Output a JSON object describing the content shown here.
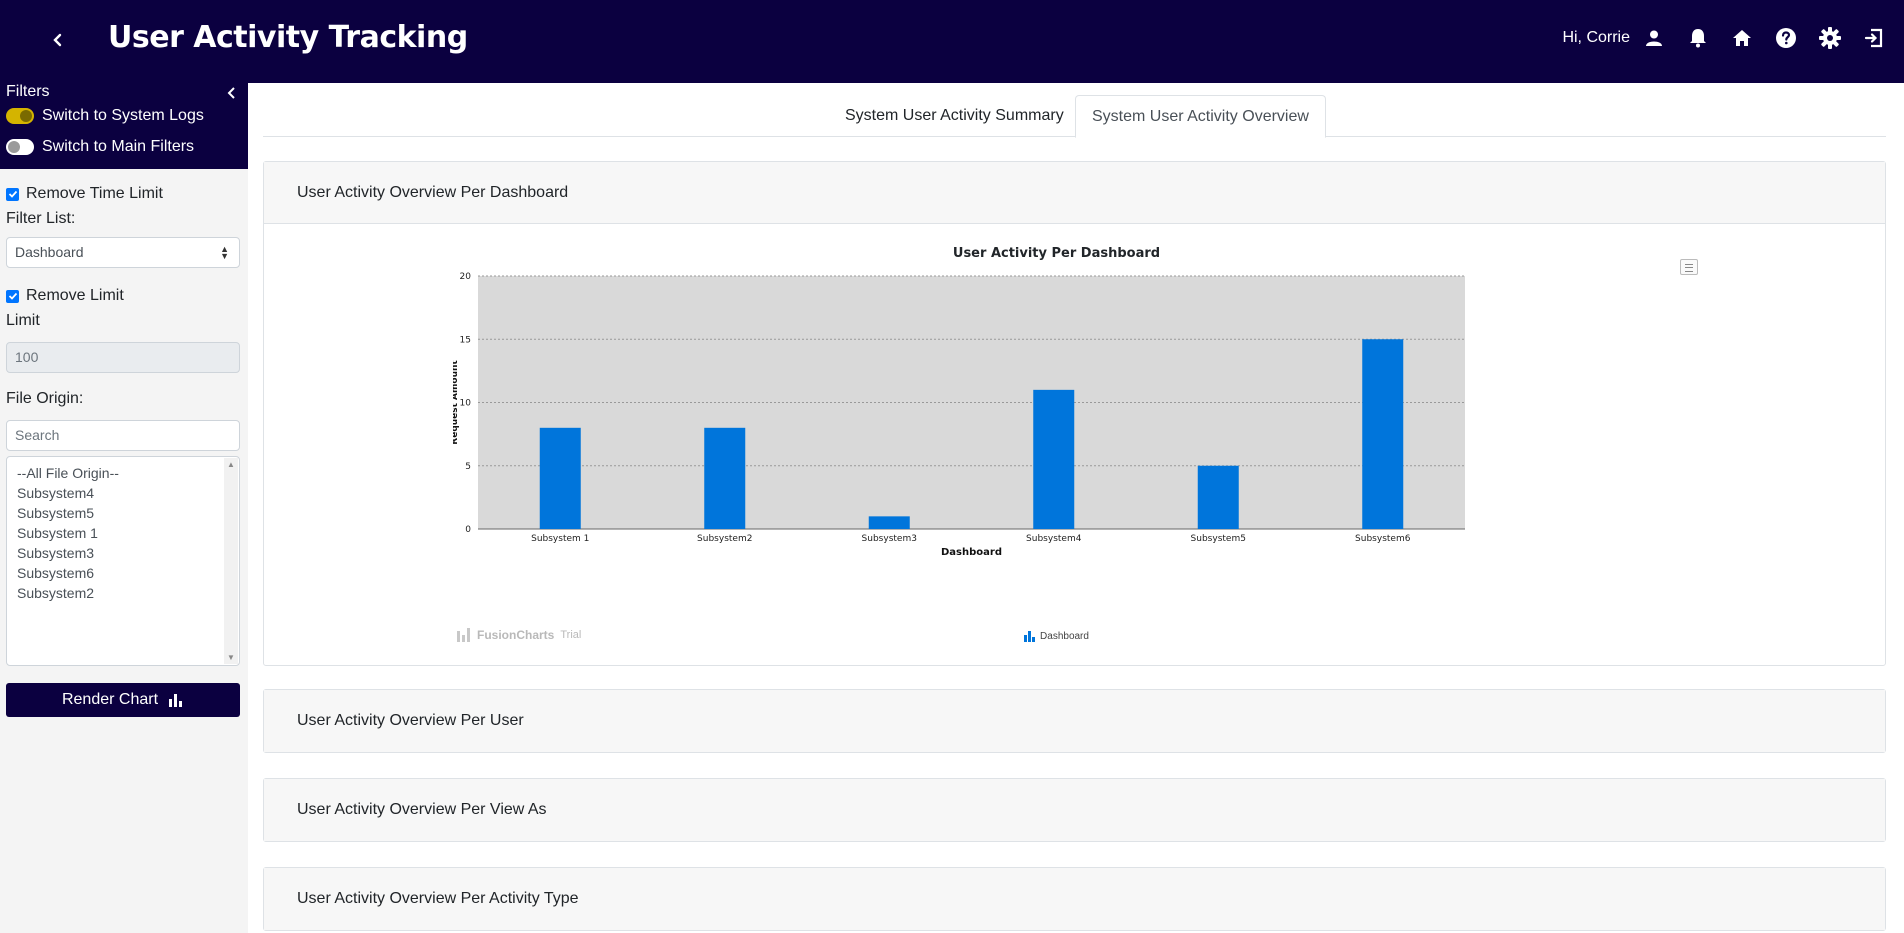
{
  "header": {
    "title": "User Activity Tracking",
    "greeting": "Hi, Corrie",
    "icons": [
      "user-icon",
      "bell-icon",
      "home-icon",
      "help-icon",
      "gear-icon",
      "logout-icon"
    ]
  },
  "sidebar": {
    "title": "Filters",
    "switch_system_logs": "Switch to System Logs",
    "switch_main_filters": "Switch to Main Filters",
    "remove_time_limit": "Remove Time Limit",
    "filter_list_label": "Filter List:",
    "filter_list_value": "Dashboard",
    "remove_limit": "Remove Limit",
    "limit_label": "Limit",
    "limit_value": "100",
    "file_origin_label": "File Origin:",
    "search_placeholder": "Search",
    "file_origin_options": [
      "--All File Origin--",
      "Subsystem4",
      "Subsystem5",
      "Subsystem 1",
      "Subsystem3",
      "Subsystem6",
      "Subsystem2"
    ],
    "render_button": "Render Chart"
  },
  "tabs": [
    {
      "label": "System User Activity Summary"
    },
    {
      "label": "System User Activity Overview"
    }
  ],
  "cards": [
    {
      "title": "User Activity Overview Per Dashboard"
    },
    {
      "title": "User Activity Overview Per User"
    },
    {
      "title": "User Activity Overview Per View As"
    },
    {
      "title": "User Activity Overview Per Activity Type"
    }
  ],
  "watermark": {
    "brand": "FusionCharts",
    "suffix": "Trial"
  },
  "chart_data": {
    "type": "bar",
    "title": "User Activity Per Dashboard",
    "xlabel": "Dashboard",
    "ylabel": "Request Amount",
    "categories": [
      "Subsystem 1",
      "Subsystem2",
      "Subsystem3",
      "Subsystem4",
      "Subsystem5",
      "Subsystem6"
    ],
    "series": [
      {
        "name": "Dashboard",
        "values": [
          8,
          8,
          1,
          11,
          5,
          15
        ]
      }
    ],
    "ylim": [
      0,
      20
    ],
    "yticks": [
      0,
      5,
      10,
      15,
      20
    ],
    "grid": true,
    "legend": "bottom-center",
    "colors": {
      "bar": "#0075db",
      "plot_bg": "#d9d9d9"
    }
  }
}
